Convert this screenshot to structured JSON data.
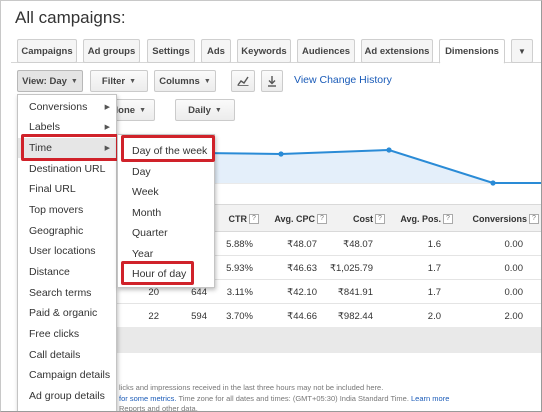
{
  "page": {
    "title": "All campaigns:"
  },
  "tabs": [
    {
      "label": "Campaigns"
    },
    {
      "label": "Ad groups"
    },
    {
      "label": "Settings"
    },
    {
      "label": "Ads"
    },
    {
      "label": "Keywords"
    },
    {
      "label": "Audiences"
    },
    {
      "label": "Ad extensions"
    },
    {
      "label": "Dimensions",
      "active": true
    },
    {
      "label": "▼"
    }
  ],
  "toolbar": {
    "view_label": "View: Day",
    "filter_label": "Filter",
    "columns_label": "Columns",
    "view_history_link": "View Change History",
    "segment_partial_label": "lone",
    "daily_label": "Daily",
    "chart_icon": "line-chart-icon",
    "download_icon": "download-icon"
  },
  "view_menu": {
    "items": [
      {
        "label": "Conversions",
        "submenu": true
      },
      {
        "label": "Labels",
        "submenu": true
      },
      {
        "label": "Time",
        "submenu": true,
        "highlighted": true
      },
      {
        "label": "Destination URL"
      },
      {
        "label": "Final URL"
      },
      {
        "label": "Top movers"
      },
      {
        "label": "Geographic"
      },
      {
        "label": "User locations"
      },
      {
        "label": "Distance"
      },
      {
        "label": "Search terms"
      },
      {
        "label": "Paid & organic"
      },
      {
        "label": "Free clicks"
      },
      {
        "label": "Call details"
      },
      {
        "label": "Campaign details"
      },
      {
        "label": "Ad group details"
      }
    ]
  },
  "time_submenu": {
    "items": [
      {
        "label": "Day of the week",
        "boxed": true
      },
      {
        "label": "Day"
      },
      {
        "label": "Week"
      },
      {
        "label": "Month"
      },
      {
        "label": "Quarter"
      },
      {
        "label": "Year"
      },
      {
        "label": "Hour of day",
        "boxed": true
      }
    ]
  },
  "table": {
    "columns": [
      {
        "label": "CTR"
      },
      {
        "label": "Avg. CPC"
      },
      {
        "label": "Cost"
      },
      {
        "label": "Avg. Pos."
      },
      {
        "label": "Conversions"
      }
    ],
    "help_glyph": "?",
    "rows": [
      {
        "clicks": "",
        "impr": "",
        "ctr": "5.88%",
        "avg_cpc": "₹48.07",
        "cost": "₹48.07",
        "avg_pos": "1.6",
        "conversions": "0.00"
      },
      {
        "clicks": "",
        "impr": "",
        "ctr": "5.93%",
        "avg_cpc": "₹46.63",
        "cost": "₹1,025.79",
        "avg_pos": "1.7",
        "conversions": "0.00"
      },
      {
        "clicks": "20",
        "impr": "644",
        "ctr": "3.11%",
        "avg_cpc": "₹42.10",
        "cost": "₹841.91",
        "avg_pos": "1.7",
        "conversions": "0.00"
      },
      {
        "clicks": "22",
        "impr": "594",
        "ctr": "3.70%",
        "avg_cpc": "₹44.66",
        "cost": "₹982.44",
        "avg_pos": "2.0",
        "conversions": "2.00"
      }
    ]
  },
  "footer": {
    "line1": "licks and impressions received in the last three hours may not be included here.",
    "line2_blue": "for some metrics.",
    "line2_rest": " Time zone for all dates and times: (GMT+05:30) India Standard Time.",
    "learn_more": "Learn more",
    "line3": "Reports and other data."
  },
  "colors": {
    "accent_link": "#1a5bb8",
    "highlight_box": "#d0222a",
    "chart_line": "#2a8bd6",
    "chart_fill": "#e4effa"
  }
}
